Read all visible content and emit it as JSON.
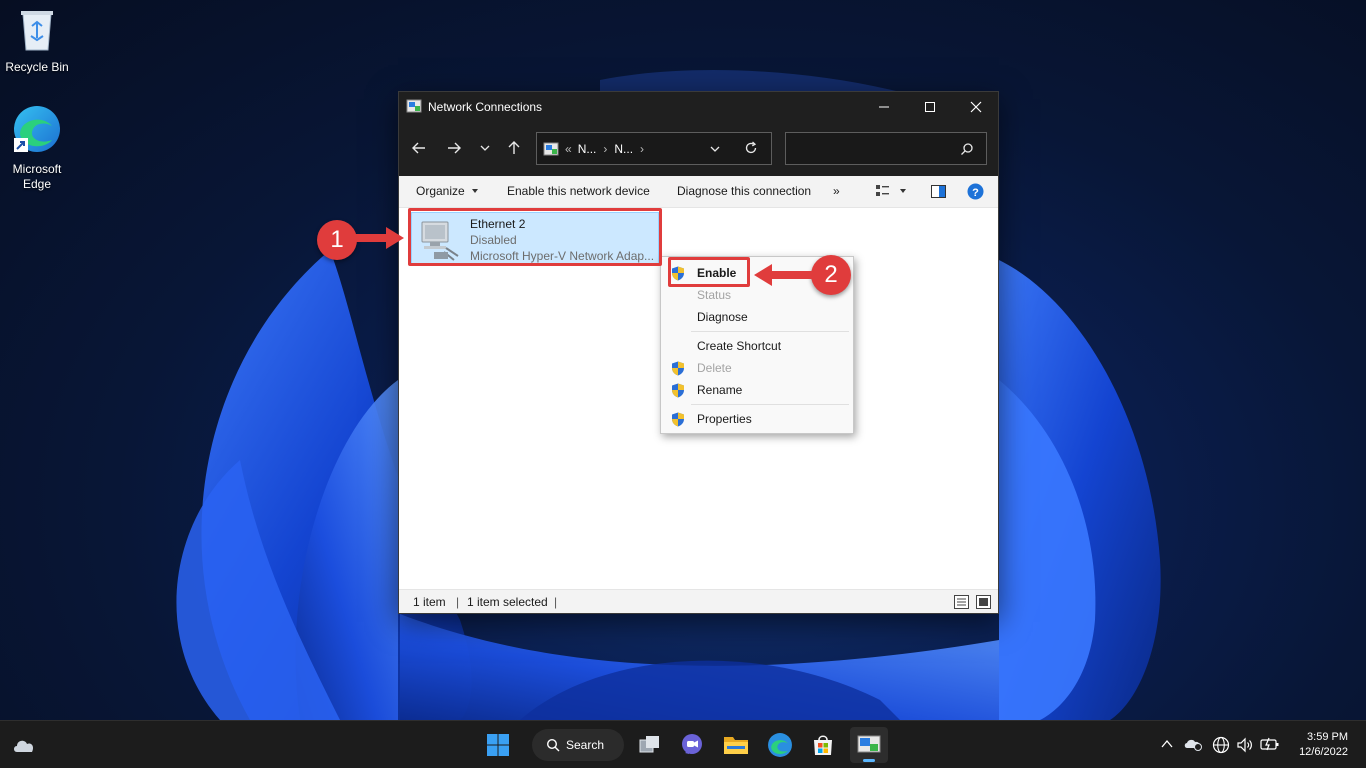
{
  "desktop": {
    "icons": [
      {
        "label": "Recycle Bin",
        "icon": "recycle-bin-icon"
      },
      {
        "label": "Microsoft Edge",
        "icon": "edge-icon"
      }
    ]
  },
  "window": {
    "title": "Network Connections",
    "address": {
      "overflow": "«",
      "crumbs": [
        "N...",
        "N..."
      ]
    },
    "search_placeholder": "",
    "commands": {
      "organize": "Organize",
      "enable_device": "Enable this network device",
      "diagnose": "Diagnose this connection",
      "more": "»"
    },
    "item": {
      "name": "Ethernet 2",
      "status": "Disabled",
      "adapter": "Microsoft Hyper-V Network Adap..."
    },
    "statusbar": {
      "count": "1 item",
      "selected": "1 item selected"
    }
  },
  "context_menu": {
    "items": [
      {
        "label": "Enable",
        "disabled": false,
        "shield": true,
        "bold": true
      },
      {
        "label": "Status",
        "disabled": true,
        "shield": false
      },
      {
        "label": "Diagnose",
        "disabled": false,
        "shield": false
      },
      {
        "label": "Create Shortcut",
        "disabled": false,
        "shield": false
      },
      {
        "label": "Delete",
        "disabled": true,
        "shield": true
      },
      {
        "label": "Rename",
        "disabled": false,
        "shield": true
      },
      {
        "label": "Properties",
        "disabled": false,
        "shield": true
      }
    ]
  },
  "annotations": {
    "step1": "1",
    "step2": "2",
    "color": "#e03c3c"
  },
  "taskbar": {
    "search_label": "Search",
    "time": "3:59 PM",
    "date": "12/6/2022"
  }
}
